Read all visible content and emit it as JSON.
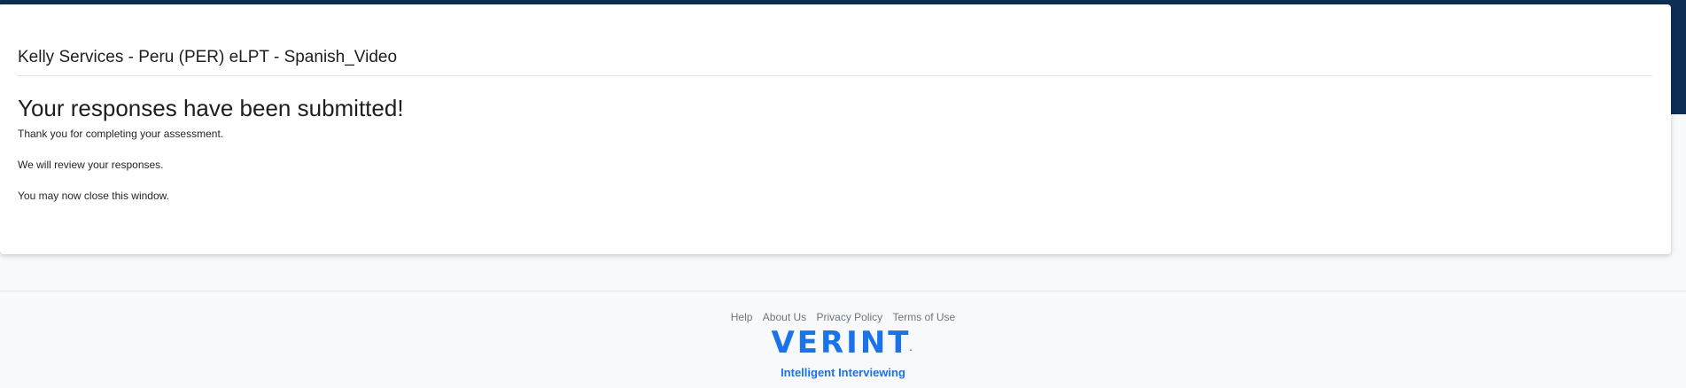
{
  "card": {
    "title": "Kelly Services - Peru (PER) eLPT - Spanish_Video",
    "heading": "Your responses have been submitted!",
    "messages": [
      "Thank you for completing your assessment.",
      "We will review your responses.",
      "You may now close this window."
    ]
  },
  "footer": {
    "links": [
      "Help",
      "About Us",
      "Privacy Policy",
      "Terms of Use"
    ],
    "brand_logo": "VERINT",
    "brand_mark": ".",
    "brand_tagline": "Intelligent Interviewing"
  },
  "colors": {
    "navy_header": "#0d2f55",
    "brand_blue": "#1a73e8",
    "footer_bg": "#f8f9fa",
    "link_gray": "#6c757d"
  }
}
